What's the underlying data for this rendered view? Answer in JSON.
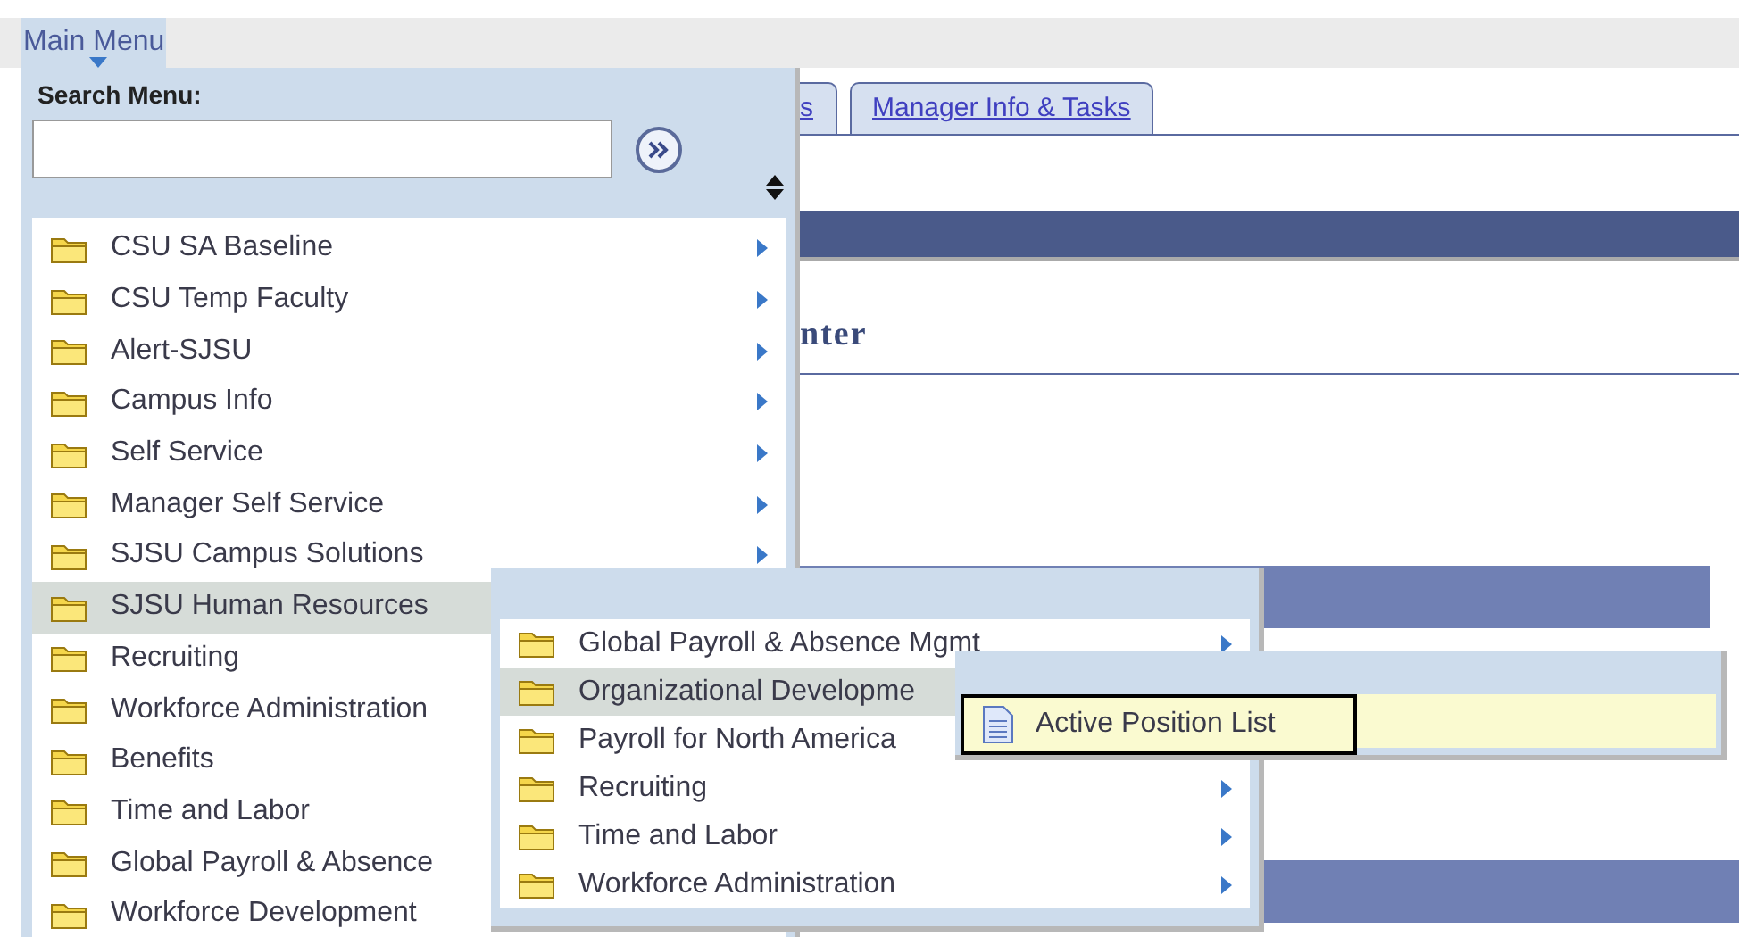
{
  "top_bar": {
    "main_menu_label": "Main Menu"
  },
  "tabs": [
    {
      "label": "s",
      "selected": false
    },
    {
      "label": "Manager Info & Tasks",
      "selected": false
    }
  ],
  "page_heading": "nter",
  "main_menu": {
    "search_label": "Search Menu:",
    "items": [
      {
        "label": "CSU SA Baseline",
        "kind": "folder",
        "selected": false,
        "has_submenu": true
      },
      {
        "label": "CSU Temp Faculty",
        "kind": "folder",
        "selected": false,
        "has_submenu": true
      },
      {
        "label": "Alert-SJSU",
        "kind": "folder",
        "selected": false,
        "has_submenu": true
      },
      {
        "label": "Campus Info",
        "kind": "folder",
        "selected": false,
        "has_submenu": true
      },
      {
        "label": "Self Service",
        "kind": "folder",
        "selected": false,
        "has_submenu": true
      },
      {
        "label": "Manager Self Service",
        "kind": "folder",
        "selected": false,
        "has_submenu": true
      },
      {
        "label": "SJSU Campus Solutions",
        "kind": "folder",
        "selected": false,
        "has_submenu": true
      },
      {
        "label": "SJSU Human Resources",
        "kind": "folder",
        "selected": true,
        "has_submenu": false
      },
      {
        "label": "Recruiting",
        "kind": "folder",
        "selected": false,
        "has_submenu": false
      },
      {
        "label": "Workforce Administration",
        "kind": "folder",
        "selected": false,
        "has_submenu": false
      },
      {
        "label": "Benefits",
        "kind": "folder",
        "selected": false,
        "has_submenu": false
      },
      {
        "label": "Time and Labor",
        "kind": "folder",
        "selected": false,
        "has_submenu": false
      },
      {
        "label": "Global Payroll & Absence",
        "kind": "folder",
        "selected": false,
        "has_submenu": false
      },
      {
        "label": "Workforce Development",
        "kind": "folder",
        "selected": false,
        "has_submenu": false
      }
    ]
  },
  "submenu": {
    "items": [
      {
        "label": "Global Payroll & Absence Mgmt",
        "kind": "folder",
        "selected": false,
        "has_submenu": true
      },
      {
        "label": "Organizational Developme",
        "kind": "folder",
        "selected": true,
        "has_submenu": false
      },
      {
        "label": "Payroll for North America",
        "kind": "folder",
        "selected": false,
        "has_submenu": false
      },
      {
        "label": "Recruiting",
        "kind": "folder",
        "selected": false,
        "has_submenu": true
      },
      {
        "label": "Time and Labor",
        "kind": "folder",
        "selected": false,
        "has_submenu": true
      },
      {
        "label": "Workforce Administration",
        "kind": "folder",
        "selected": false,
        "has_submenu": true
      }
    ]
  },
  "submenu_2": {
    "items": [
      {
        "label": "Active Position List",
        "kind": "page",
        "selected": true,
        "has_submenu": false
      }
    ]
  }
}
